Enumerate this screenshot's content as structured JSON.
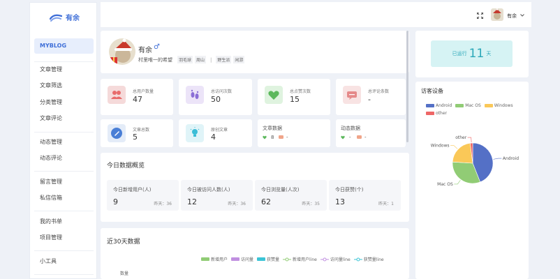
{
  "logo": {
    "text": "有余"
  },
  "sidebar": {
    "active": "MYBLOG",
    "items": [
      "文章管理",
      "文章筛选",
      "分类管理",
      "文章评论",
      "动态管理",
      "动态评论",
      "留言管理",
      "私信信箱",
      "我的书单",
      "项目管理",
      "小工具"
    ]
  },
  "topbar": {
    "user": "有余"
  },
  "profile": {
    "name": "有余",
    "gender": "♂",
    "motto": "村里唯一的希望",
    "tags": [
      "羽毛球",
      "周山"
    ],
    "tags2": [
      "野生派",
      "闲游"
    ],
    "sep": "|"
  },
  "stats": [
    {
      "label": "总用户数量",
      "value": "47",
      "color": "#f5dada",
      "icon": "users-icon"
    },
    {
      "label": "总访问次数",
      "value": "50",
      "color": "#ece4f8",
      "icon": "footprints-icon"
    },
    {
      "label": "总点赞次数",
      "value": "15",
      "color": "#dff3df",
      "icon": "heart-icon"
    },
    {
      "label": "总评论条数",
      "value": "-",
      "color": "#f8e3e3",
      "icon": "comment-icon"
    },
    {
      "label": "文章总数",
      "value": "5",
      "color": "#e4ecf8",
      "icon": "pen-icon"
    },
    {
      "label": "原创文章",
      "value": "4",
      "color": "#e0f4f8",
      "icon": "bulb-icon"
    }
  ],
  "article_data": {
    "title": "文章数据",
    "likes": "8",
    "comments": "-"
  },
  "moment_data": {
    "title": "动态数据",
    "likes": "-",
    "comments": "-"
  },
  "running": {
    "prefix": "已运行",
    "days": "11",
    "suffix": "天"
  },
  "today": {
    "title": "今日数据概览",
    "boxes": [
      {
        "label": "今日新增用户(人)",
        "value": "9",
        "yesterday": "昨天：36"
      },
      {
        "label": "今日被访问人数(人)",
        "value": "12",
        "yesterday": "昨天：36"
      },
      {
        "label": "今日浏览量(人次)",
        "value": "62",
        "yesterday": "昨天：35"
      },
      {
        "label": "今日获赞(个)",
        "value": "13",
        "yesterday": "昨天：1"
      }
    ]
  },
  "chart30": {
    "title": "近30天数据",
    "ylabel": "数量",
    "legend": [
      {
        "name": "新增用户",
        "color": "#91cc75",
        "kind": "bar"
      },
      {
        "name": "访问量",
        "color": "#c08fe0",
        "kind": "bar"
      },
      {
        "name": "获赞量",
        "color": "#3bc4d6",
        "kind": "bar"
      },
      {
        "name": "新增用户line",
        "color": "#91cc75",
        "kind": "line"
      },
      {
        "name": "访问量line",
        "color": "#c08fe0",
        "kind": "line"
      },
      {
        "name": "获赞量line",
        "color": "#3bc4d6",
        "kind": "line"
      }
    ]
  },
  "visitor": {
    "title": "访客设备"
  },
  "chart_data": {
    "type": "pie",
    "categories": [
      "Android",
      "Mac OS",
      "Windows",
      "other"
    ],
    "values": [
      44,
      32,
      22,
      2
    ],
    "colors": [
      "#5470c6",
      "#91cc75",
      "#fac858",
      "#ee6666"
    ],
    "legend_position": "top-left"
  }
}
